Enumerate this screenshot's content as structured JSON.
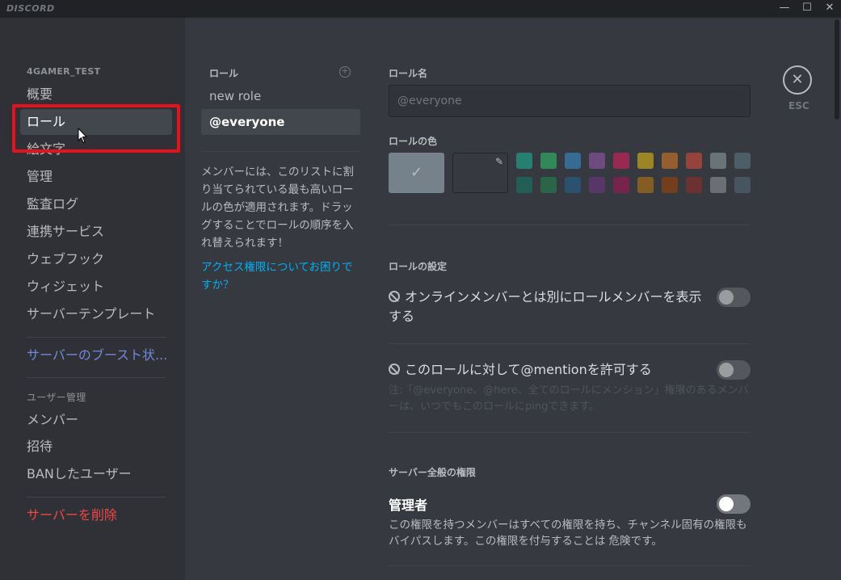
{
  "titlebar": {
    "logo": "DISCORD",
    "minimize": "—",
    "maximize": "☐",
    "close": "✕"
  },
  "sidebar": {
    "server_name": "4GAMER_TEST",
    "items": [
      {
        "label": "概要"
      },
      {
        "label": "ロール"
      },
      {
        "label": "絵文字"
      },
      {
        "label": "管理"
      },
      {
        "label": "監査ログ"
      },
      {
        "label": "連携サービス"
      },
      {
        "label": "ウェブフック"
      },
      {
        "label": "ウィジェット"
      },
      {
        "label": "サーバーテンプレート"
      }
    ],
    "boost_label": "サーバーのブースト状...",
    "user_mgmt_header": "ユーザー管理",
    "user_items": [
      {
        "label": "メンバー"
      },
      {
        "label": "招待"
      },
      {
        "label": "BANしたユーザー"
      }
    ],
    "delete_label": "サーバーを削除"
  },
  "roles": {
    "header": "ロール",
    "add_icon": "+",
    "items": [
      {
        "label": "new role"
      },
      {
        "label": "@everyone"
      }
    ],
    "description": "メンバーには、このリストに割り当てられている最も高いロールの色が適用されます。ドラッグすることでロールの順序を入れ替えられます！",
    "help_link": "アクセス権限についてお困りですか？"
  },
  "editor": {
    "role_name_label": "ロール名",
    "role_name_value": "@everyone",
    "role_color_label": "ロールの色",
    "check_mark": "✓",
    "pipette_icon": "✎",
    "palette_top": [
      "#1abc9c",
      "#2ecc71",
      "#3498db",
      "#9b59b6",
      "#e91e63",
      "#f1c40f",
      "#e67e22",
      "#e74c3c",
      "#95a5a6",
      "#607d8b"
    ],
    "palette_bottom": [
      "#11806a",
      "#1f8b4c",
      "#206694",
      "#71368a",
      "#ad1457",
      "#c27c0e",
      "#a84300",
      "#992d22",
      "#979c9f",
      "#546e7a"
    ],
    "role_settings_label": "ロールの設定",
    "hoist_label": "オンラインメンバーとは別にロールメンバーを表示する",
    "mention_label": "このロールに対して@mentionを許可する",
    "mention_note": "注:「@everyone、@here、全てのロールにメンション」権限のあるメンバーは、いつでもこのロールにpingできます。",
    "general_perms_label": "サーバー全般の権限",
    "admin_title": "管理者",
    "admin_desc": "この権限を持つメンバーはすべての権限を持ち、チャンネル固有の権限もバイパスします。この権限を付与することは 危険です。"
  },
  "close_button": {
    "icon": "✕",
    "label": "ESC"
  }
}
